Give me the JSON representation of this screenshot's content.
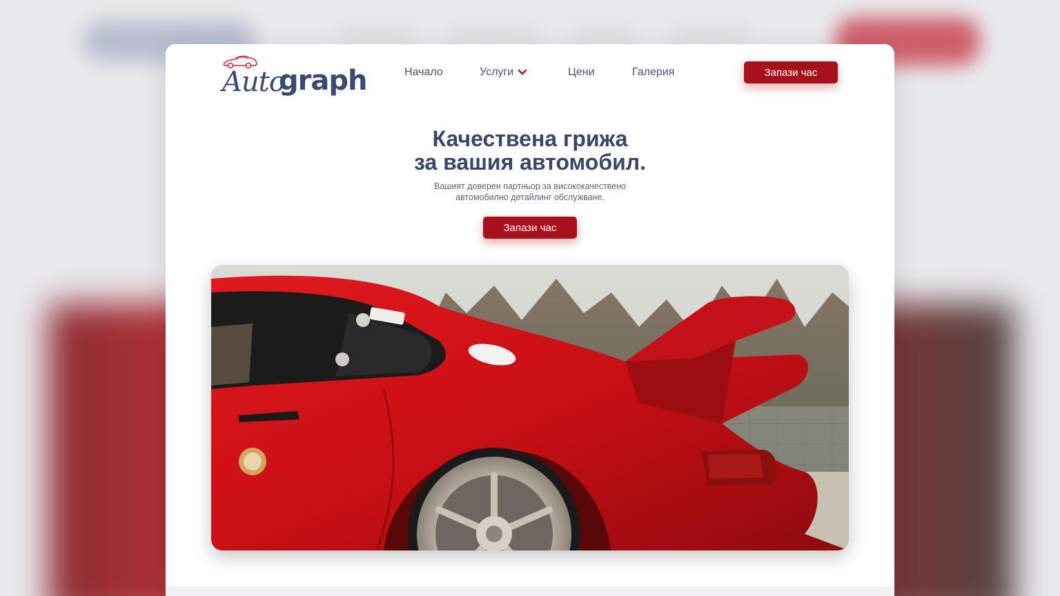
{
  "brand": {
    "logo_left": "Auto",
    "logo_right": "graph"
  },
  "nav": {
    "home": "Начало",
    "services": "Услуги",
    "prices": "Цени",
    "gallery": "Галерия"
  },
  "header_cta": "Запази час",
  "hero": {
    "title_line1": "Качествена грижа",
    "title_line2": "за вашия автомобил.",
    "subtitle_line1": "Вашият доверен партньор за висококачествено",
    "subtitle_line2": "автомобилно детайлинг обслужване.",
    "cta": "Запази час"
  },
  "colors": {
    "brand_red": "#a8111c",
    "brand_navy": "#3b4a72"
  },
  "icons": {
    "logo_car": "car-outline-icon",
    "services_dropdown": "chevron-down-icon"
  }
}
